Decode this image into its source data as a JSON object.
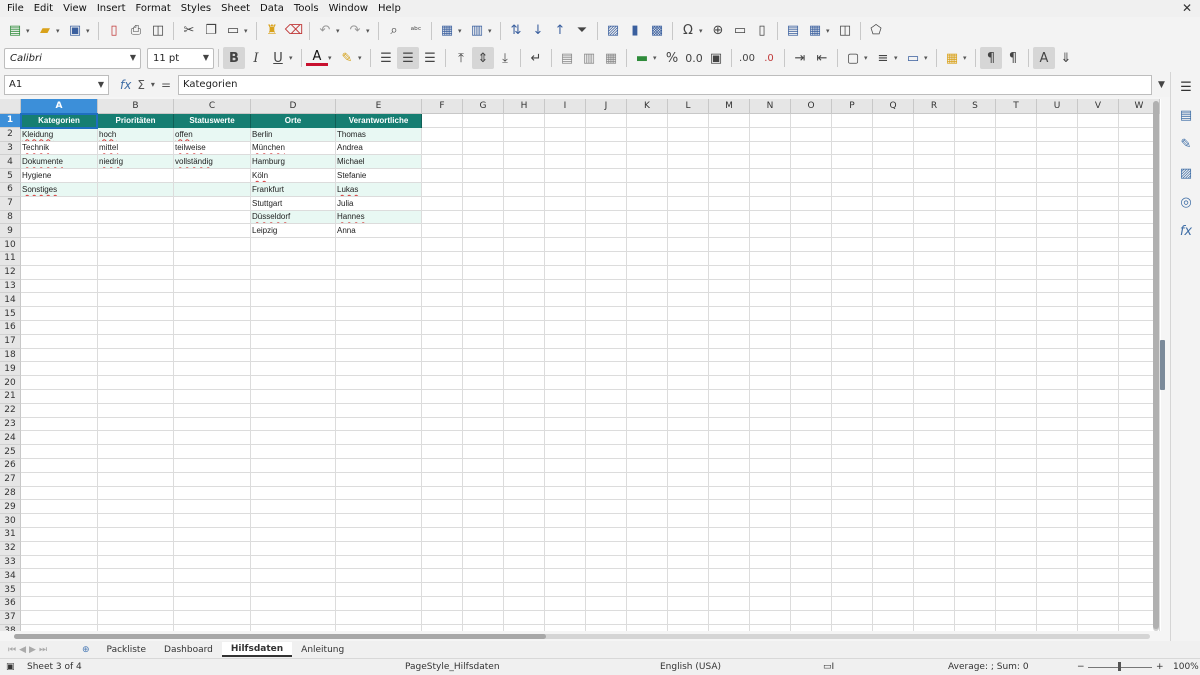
{
  "menu": [
    "File",
    "Edit",
    "View",
    "Insert",
    "Format",
    "Styles",
    "Sheet",
    "Data",
    "Tools",
    "Window",
    "Help"
  ],
  "formatting": {
    "font_name": "Calibri",
    "font_size": "11 pt"
  },
  "formula_bar": {
    "cell_ref": "A1",
    "content": "Kategorien"
  },
  "columns": [
    "A",
    "B",
    "C",
    "D",
    "E",
    "F",
    "G",
    "H",
    "I",
    "J",
    "K",
    "L",
    "M",
    "N",
    "O",
    "P",
    "Q",
    "R",
    "S",
    "T",
    "U",
    "V",
    "W"
  ],
  "rows": [
    "1",
    "2",
    "3",
    "4",
    "5",
    "6",
    "7",
    "8",
    "9",
    "10",
    "11",
    "12",
    "13",
    "14",
    "15",
    "16",
    "17",
    "18",
    "19",
    "20",
    "21",
    "22",
    "23",
    "24",
    "25",
    "26",
    "27",
    "28",
    "29",
    "30",
    "31",
    "32",
    "33",
    "34",
    "35",
    "36",
    "37",
    "38"
  ],
  "sheet": {
    "headers": [
      "Kategorien",
      "Prioritäten",
      "Statuswerte",
      "Orte",
      "Verantwortliche"
    ],
    "rows": [
      [
        "Kleidung",
        "hoch",
        "offen",
        "Berlin",
        "Thomas"
      ],
      [
        "Technik",
        "mittel",
        "teilweise",
        "München",
        "Andrea"
      ],
      [
        "Dokumente",
        "niedrig",
        "vollständig",
        "Hamburg",
        "Michael"
      ],
      [
        "Hygiene",
        "",
        "",
        "Köln",
        "Stefanie"
      ],
      [
        "Sonstiges",
        "",
        "",
        "Frankfurt",
        "Lukas"
      ],
      [
        "",
        "",
        "",
        "Stuttgart",
        "Julia"
      ],
      [
        "",
        "",
        "",
        "Düsseldorf",
        "Hannes"
      ],
      [
        "",
        "",
        "",
        "Leipzig",
        "Anna"
      ]
    ]
  },
  "tabs": [
    "Packliste",
    "Dashboard",
    "Hilfsdaten",
    "Anleitung"
  ],
  "active_tab": "Hilfsdaten",
  "status": {
    "sheet": "Sheet 3 of 4",
    "page_style": "PageStyle_Hilfsdaten",
    "language": "English (USA)",
    "summary": "Average: ; Sum: 0",
    "zoom": "100%"
  },
  "colors": {
    "header_fill": "#167e72",
    "band_fill": "#e8f8f3",
    "selection": "#1f6fc0"
  }
}
